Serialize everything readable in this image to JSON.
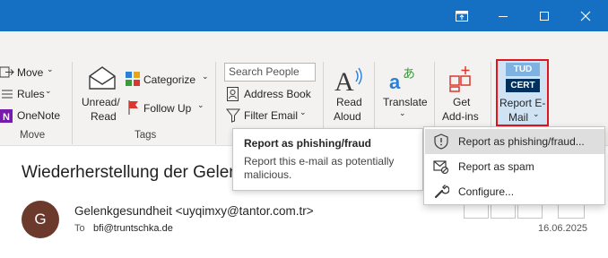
{
  "colors": {
    "titlebar": "#1570c4",
    "accent_red": "#e0161e",
    "avatar": "#6b3a2c"
  },
  "titlebar": {
    "restore_icon": "restore-ribbon-icon",
    "minimize_icon": "minimize-icon",
    "maximize_icon": "maximize-icon",
    "close_icon": "close-icon"
  },
  "ribbon": {
    "move_group": {
      "move": "Move",
      "rules": "Rules",
      "onenote": "OneNote",
      "label": "Move"
    },
    "tags_group": {
      "unread_line1": "Unread/",
      "unread_line2": "Read",
      "categorize": "Categorize",
      "follow_up": "Follow Up",
      "label": "Tags"
    },
    "find_group": {
      "search_placeholder": "Search People",
      "address_book": "Address Book",
      "filter_email": "Filter Email"
    },
    "read_aloud": {
      "line1": "Read",
      "line2": "Aloud"
    },
    "translate": {
      "label": "Translate"
    },
    "get_addins": {
      "line1": "Get",
      "line2": "Add-ins"
    },
    "report_email": {
      "line1": "Report E-",
      "line2": "Mail",
      "icon_top": "TUD",
      "icon_bottom": "CERT"
    }
  },
  "tooltip": {
    "title": "Report as phishing/fraud",
    "description": "Report this e-mail as potentially malicious."
  },
  "menu": {
    "items": [
      {
        "label": "Report as phishing/fraud...",
        "icon": "shield-alert-icon",
        "highlighted": true
      },
      {
        "label": "Report as spam",
        "icon": "mail-block-icon",
        "highlighted": false
      },
      {
        "label": "Configure...",
        "icon": "wrench-icon",
        "highlighted": false
      }
    ]
  },
  "message": {
    "subject": "Wiederherstellung der Gelen",
    "avatar_initial": "G",
    "sender": "Gelenkgesundheit <uyqimxy@tantor.com.tr>",
    "to_label": "To",
    "to_value": "bfi@truntschka.de",
    "date": "16.06.2025"
  }
}
